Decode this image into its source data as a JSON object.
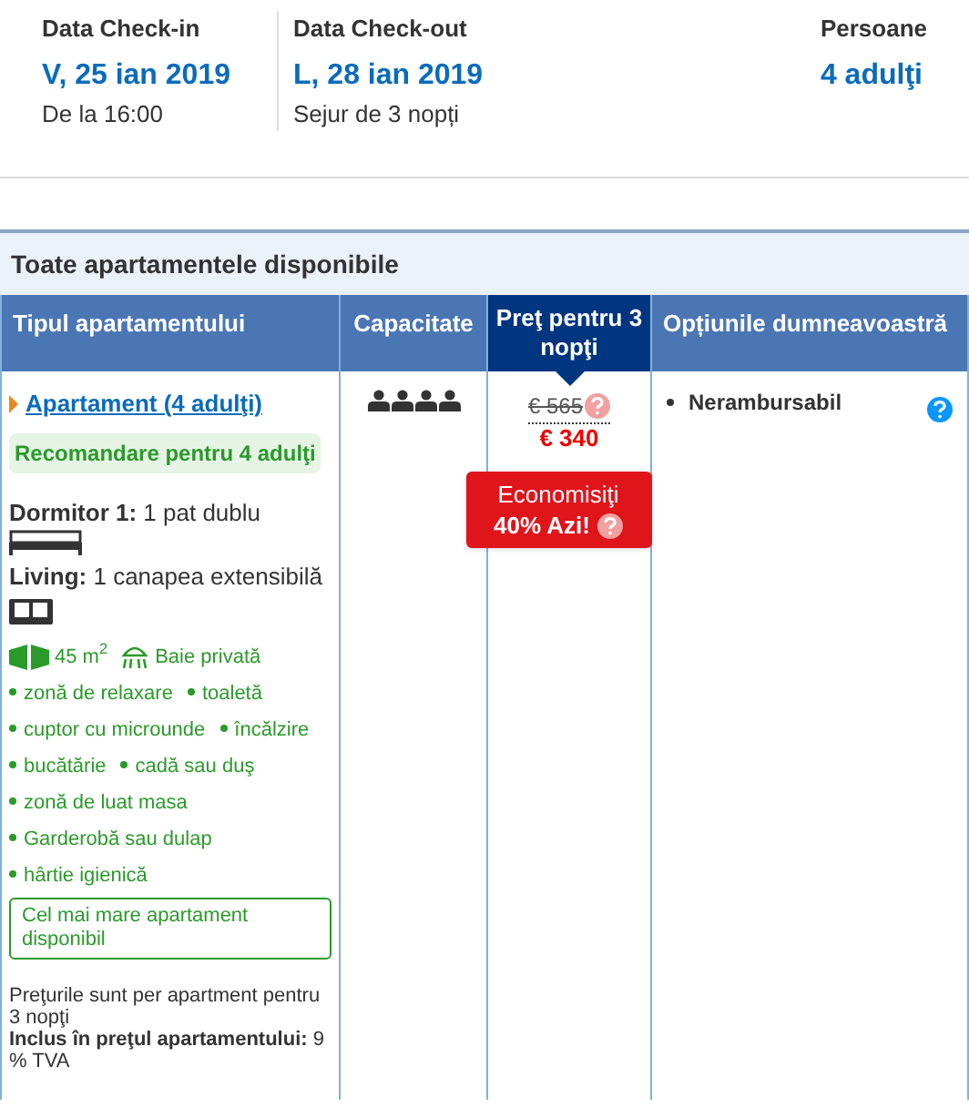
{
  "stay": [
    {
      "label": "Data Check-in",
      "value": "V, 25 ian 2019",
      "note": "De la 16:00"
    },
    {
      "label": "Data Check-out",
      "value": "L, 28 ian 2019",
      "note": "Sejur de 3 nopți"
    },
    {
      "label": "Persoane",
      "value": "4 adulţi"
    }
  ],
  "section_title": "Toate apartamentele disponibile",
  "table": {
    "columns": [
      {
        "label": "Tipul apartamentului",
        "selected": false
      },
      {
        "label": "Capacitate",
        "selected": false
      },
      {
        "label": "Preţ pentru 3 nopţi",
        "selected": true
      },
      {
        "label": "Opțiunile dumneavoastră",
        "selected": false
      }
    ],
    "row": {
      "name": "Apartament (4 adulţi)",
      "recommendation": "Recomandare pentru 4 adulţi",
      "beds": [
        {
          "text": "**Dormitor 1:** 1 pat dublu",
          "kind": "bed"
        },
        {
          "text": "**Living:** 1 canapea extensibilă",
          "kind": "sofa"
        }
      ],
      "area": "45 m$^{2}$",
      "bathroom": "Baie privată",
      "amenity_lines": [
        [
          "zonă de relaxare",
          "toaletă"
        ],
        [
          "cuptor cu microunde",
          "încălzire"
        ],
        [
          "bucătărie",
          "cadă sau duş"
        ],
        [
          "zonă de luat masa"
        ],
        [
          "Garderobă sau dulap"
        ],
        [
          "hârtie igienică"
        ]
      ],
      "highlight": "Cel mai mare apartament disponibil",
      "price_note": "Preţurile sunt per apartment pentru 3 nopţi",
      "tax_note": "**Inclus în preţul apartamentului:** 9 % TVA",
      "capacity": [
        {
          "kind": "person"
        },
        {
          "kind": "person"
        },
        {
          "kind": "person"
        },
        {
          "kind": "person"
        }
      ],
      "old_price": "€ 565",
      "price": "€ 340",
      "deal_line_1": "Economisiţi",
      "deal_line_2": "40% Azi!",
      "options": [
        "Nerambursabil"
      ]
    }
  }
}
